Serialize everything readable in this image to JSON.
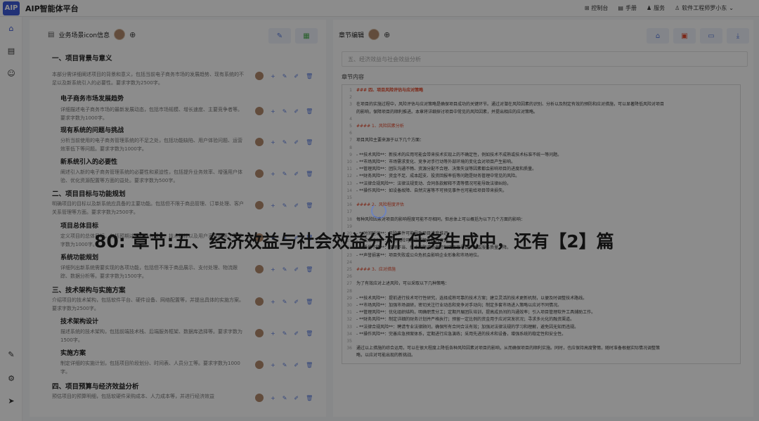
{
  "app": {
    "logo": "AIP",
    "title": "AIP智能体平台"
  },
  "topnav": [
    {
      "label": "控制台",
      "icon": "dashboard-icon",
      "glyph": "⊞"
    },
    {
      "label": "手册",
      "icon": "manual-icon",
      "glyph": "▤"
    },
    {
      "label": "服务",
      "icon": "service-icon",
      "glyph": "♟"
    },
    {
      "label": "软件工程师罗小东",
      "icon": "user-icon",
      "glyph": "♙",
      "caret": "⌄"
    }
  ],
  "left_panel": {
    "title": "业务场景icon信息",
    "sections": [
      {
        "type": "sec",
        "text": "一、项目背景与意义"
      },
      {
        "type": "desc",
        "level": 1,
        "text": "本部分需详细阐述项目的背景和意义，包括当前电子商务市场的发展趋势、现有系统的不足以及新系统引入的必要性。要求字数为2500字。"
      },
      {
        "type": "sub",
        "text": "电子商务市场发展趋势"
      },
      {
        "type": "desc",
        "text": "详细描述电子商务市场的最新发展动态，包括市场规模、增长速度、主要竞争者等。要求字数为1000字。"
      },
      {
        "type": "sub",
        "text": "现有系统的问题与挑战"
      },
      {
        "type": "desc",
        "text": "分析当前使用的电子商务管理系统的不足之处，包括功能缺陷、用户体验问题、运营效率低下等问题。要求字数为1000字。"
      },
      {
        "type": "sub",
        "text": "新系统引入的必要性"
      },
      {
        "type": "desc",
        "text": "阐述引入新的电子商务管理系统的必要性和紧迫性，包括提升业务效率、增强用户体验、优化资源配置等方面的益处。要求字数为500字。"
      },
      {
        "type": "sec",
        "text": "二、项目目标与功能规划"
      },
      {
        "type": "desc",
        "level": 1,
        "text": "明确项目的目标以及新系统应具备的主要功能。包括但不限于商品管理、订单处理、客户关系管理等方面。要求字数为2500字。"
      },
      {
        "type": "sub",
        "text": "项目总体目标"
      },
      {
        "type": "desc",
        "text": "定义项目的总体目标，包括预期达成的业务成果、技术指标以及用户满意度等。要求字数为1000字。"
      },
      {
        "type": "sub",
        "text": "系统功能规划"
      },
      {
        "type": "desc",
        "text": "详细列出新系统需要实现的各项功能，包括但不限于商品展示、支付处理、物流跟踪、数据分析等。要求字数为1500字。"
      },
      {
        "type": "sec",
        "text": "三、技术架构与实施方案"
      },
      {
        "type": "desc",
        "level": 1,
        "text": "介绍项目的技术架构，包括软件平台、硬件设备、网络配置等，并提出具体的实施方案。要求字数为2500字。"
      },
      {
        "type": "sub",
        "text": "技术架构设计"
      },
      {
        "type": "desc",
        "text": "描述系统的技术架构，包括前端技术栈、后端服务框架、数据库选择等。要求字数为1500字。"
      },
      {
        "type": "sub",
        "text": "实施方案"
      },
      {
        "type": "desc",
        "text": "制定详细的实施计划，包括项目阶段划分、时间表、人员分工等。要求字数为1000字。"
      },
      {
        "type": "sec",
        "text": "四、项目预算与经济效益分析"
      },
      {
        "type": "desc",
        "level": 1,
        "text": "预估项目的预算明细，包括软硬件采购成本、人力成本等，并进行经济效益"
      }
    ]
  },
  "right_panel": {
    "title": "章节编辑",
    "chapter_placeholder": "五、经济效益与社会效益分析",
    "content_label": "章节内容",
    "lines": [
      {
        "n": "1",
        "t": "### 四、项目风险评估与应对策略",
        "k": "h"
      },
      {
        "n": "2",
        "t": "",
        "k": ""
      },
      {
        "n": "3",
        "t": "在项目的实施过程中，风险评估与应对策略是确保项目成功的关键环节。通过对潜在风险因素的识别、分析以及制定有效的预防和应对措施，可以显著降低风险对项目",
        "k": ""
      },
      {
        "n": "",
        "t": "的影响，保障项目的顺利推进。本章将详细探讨项目中常见的风险因素，并提出相应的应对策略。",
        "k": ""
      },
      {
        "n": "4",
        "t": "",
        "k": ""
      },
      {
        "n": "5",
        "t": "#### 1、风险因素分析",
        "k": "h4"
      },
      {
        "n": "6",
        "t": "",
        "k": ""
      },
      {
        "n": "7",
        "t": "项目风险主要来源于以下几个方面：",
        "k": ""
      },
      {
        "n": "8",
        "t": "",
        "k": ""
      },
      {
        "n": "9",
        "t": "- **技术风险**：新技术的应用可能会带来技术实现上的不确定性，例如技术不成熟或技术标准不统一等问题。",
        "k": "li"
      },
      {
        "n": "10",
        "t": "- **市场风险**：市场需求变化、竞争对手行动等外部环境的变化会对项目产生影响。",
        "k": "li"
      },
      {
        "n": "11",
        "t": "- **管理风险**：团队沟通不畅、资源分配不合理、决策失误等因素都会影响项目的进度和质量。",
        "k": "li"
      },
      {
        "n": "12",
        "t": "- **财务风险**：资金不足、成本超支、投资回报率低等问题是财务管理中常见的风险。",
        "k": "li"
      },
      {
        "n": "13",
        "t": "- **法律合规风险**：法律法规变动、合同条款解释不清等情况可能导致法律纠纷。",
        "k": "li"
      },
      {
        "n": "14",
        "t": "- **操作风险**：如设备故障、自然灾害等不可预见事件也可能给项目带来损失。",
        "k": "li"
      },
      {
        "n": "15",
        "t": "",
        "k": ""
      },
      {
        "n": "16",
        "t": "#### 2、风险程度评估",
        "k": "h4"
      },
      {
        "n": "17",
        "t": "",
        "k": ""
      },
      {
        "n": "18",
        "t": "每种风险因素对项目的影响程度可能不尽相同，但总体上可以概括为以下几个方面的影响：",
        "k": ""
      },
      {
        "n": "19",
        "t": "",
        "k": ""
      },
      {
        "n": "20",
        "t": "- **时间延误**：风险事件可能导致项目进度推迟。",
        "k": "li"
      },
      {
        "n": "21",
        "t": "- **成本增加**：应对风险可能需要额外投入资源。",
        "k": "li"
      },
      {
        "n": "22",
        "t": "- **质量下降**：管理不当、技术问题或质量控制疏忽等导致产品或服务质量下降。",
        "k": "li"
      },
      {
        "n": "23",
        "t": "- **声誉损害**：项目失败或公众危机会影响企业形象和市场地位。",
        "k": "li"
      },
      {
        "n": "24",
        "t": "",
        "k": ""
      },
      {
        "n": "25",
        "t": "#### 3、应对措施",
        "k": "h4"
      },
      {
        "n": "26",
        "t": "",
        "k": ""
      },
      {
        "n": "27",
        "t": "为了有效应对上述风险，可以采取以下几种策略：",
        "k": ""
      },
      {
        "n": "28",
        "t": "",
        "k": ""
      },
      {
        "n": "29",
        "t": "- **技术风险**：提前进行技术可行性研究，选择成熟可靠的技术方案；建立灵活的技术更新机制，以便及时调整技术路线。",
        "k": "li"
      },
      {
        "n": "30",
        "t": "- **市场风险**：加强市场调研，密切关注行业动态和竞争对手动向；制定多套市场进入策略以应对不同情况。",
        "k": "li"
      },
      {
        "n": "31",
        "t": "- **管理风险**：优化组织结构，明确职责分工；定期开展团队培训，提高成员间的沟通效率；引入项目管理软件工具辅助工作。",
        "k": "li"
      },
      {
        "n": "32",
        "t": "- **财务风险**：制定详细的财务计划并严格执行；预留一定比例的资金用于应对突发状况；寻求多元化的融资渠道。",
        "k": "li"
      },
      {
        "n": "33",
        "t": "- **法律合规风险**：聘请专业法律顾问，确保所有合同合法有效；加强对法律法规的学习和理解，避免因无知而违规。",
        "k": "li"
      },
      {
        "n": "34",
        "t": "- **操作风险**：完善应急预案体系，定期进行应急演练；采用先进的技术和设备，增强系统的稳定性和安全性。",
        "k": "li"
      },
      {
        "n": "35",
        "t": "",
        "k": ""
      },
      {
        "n": "36",
        "t": "通过以上措施的综合运用，可以在很大程度上降低各种风险因素对项目的影响，从而确保项目的顺利实施。同时，也应保持高度警惕，随时准备根据实际情况调整策",
        "k": ""
      },
      {
        "n": "",
        "t": "略，以应对可能出现的新挑战。",
        "k": ""
      }
    ]
  },
  "status_text": "80: 章节:五、经济效益与社会效益分析 任务生成中，还有【2】篇"
}
